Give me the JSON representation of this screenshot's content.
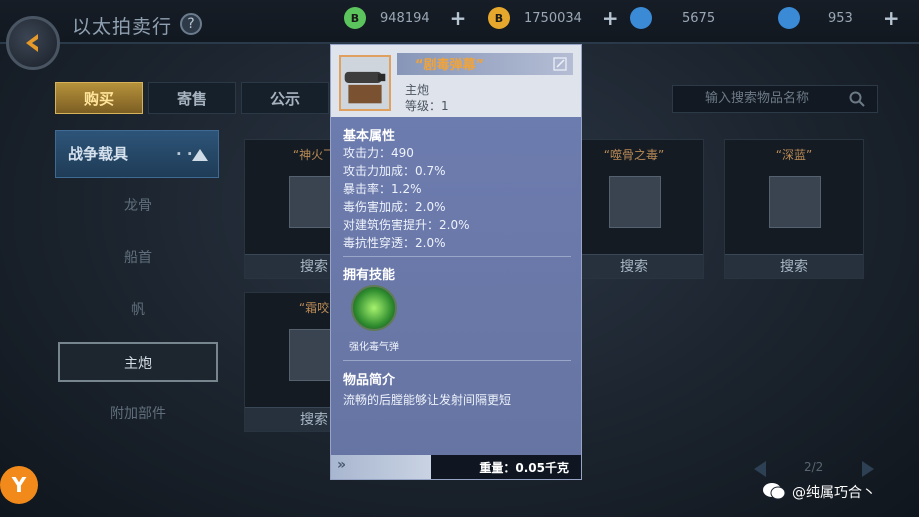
{
  "header": {
    "title": "以太拍卖行",
    "help_icon": "?",
    "resources": [
      {
        "icon": "green-coin-icon",
        "label": "B",
        "value": "948194",
        "color": "#5cc45c"
      },
      {
        "icon": "gold-coin-icon",
        "label": "B",
        "value": "1750034",
        "color": "#e6a72d"
      },
      {
        "icon": "blue-gear-icon",
        "label": "",
        "value": "5675",
        "color": "#3a8ad6"
      },
      {
        "icon": "blue-crystal-icon",
        "label": "",
        "value": "953",
        "color": "#3a8ad6"
      }
    ],
    "plus": "+"
  },
  "tabs": [
    {
      "label": "购买",
      "active": true
    },
    {
      "label": "寄售",
      "active": false
    },
    {
      "label": "公示",
      "active": false
    }
  ],
  "search": {
    "placeholder": "输入搜索物品名称"
  },
  "sidebar": {
    "header": "战争载具",
    "dots": "·  ·",
    "items": [
      {
        "label": "龙骨",
        "active": false
      },
      {
        "label": "船首",
        "active": false
      },
      {
        "label": "帆",
        "active": false
      },
      {
        "label": "主炮",
        "active": true
      },
      {
        "label": "附加部件",
        "active": false
      }
    ]
  },
  "grid": {
    "items": [
      {
        "name": "“神火飞",
        "button": "搜索"
      },
      {
        "name": "“噬骨之毒”",
        "button": "搜索"
      },
      {
        "name": "“深蓝”",
        "button": "搜索"
      },
      {
        "name": "“霜咬",
        "button": "搜索"
      }
    ]
  },
  "pager": {
    "text": "2/2"
  },
  "popup": {
    "name": "“剧毒弹幕”",
    "type": "主炮",
    "level": "等级：1",
    "basic_title": "基本属性",
    "stats": [
      "攻击力：490",
      "攻击力加成：0.7%",
      "暴击率：1.2%",
      "毒伤害加成：2.0%",
      "对建筑伤害提升：2.0%",
      "毒抗性穿透：2.0%"
    ],
    "skill_title": "拥有技能",
    "skill_name": "强化毒气弹",
    "intro_title": "物品简介",
    "intro_text": "流畅的后膛能够让发射间隔更短",
    "weight": "重量：0.05千克"
  },
  "watermark": {
    "logo": "Y",
    "text": "@纯属巧合丶"
  }
}
